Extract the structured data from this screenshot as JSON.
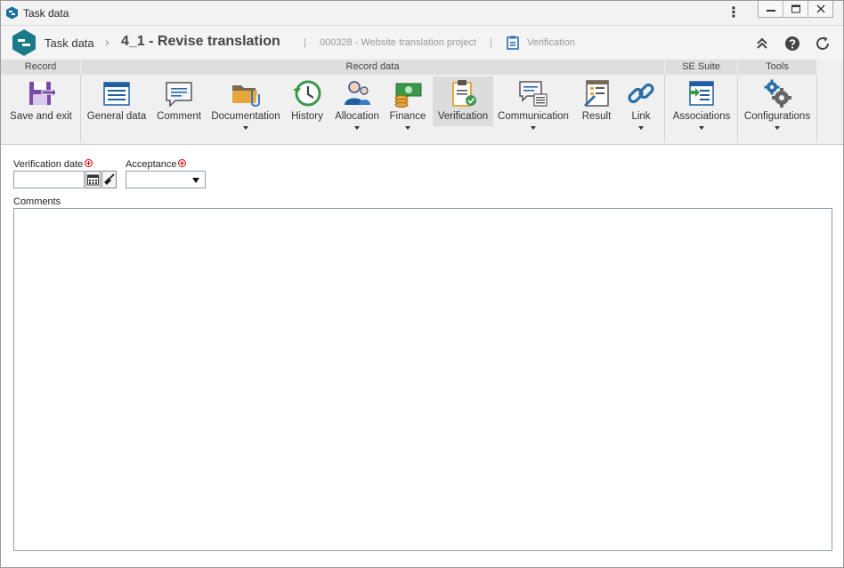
{
  "window": {
    "title": "Task data"
  },
  "header": {
    "task_label": "Task data",
    "main_title": "4_1 - Revise translation",
    "project": "000328 - Website translation project",
    "section": "Verification"
  },
  "ribbon": {
    "groups": {
      "record": "Record",
      "record_data": "Record data",
      "se_suite": "SE Suite",
      "tools": "Tools"
    },
    "buttons": {
      "save_exit": "Save and exit",
      "general_data": "General data",
      "comment": "Comment",
      "documentation": "Documentation",
      "history": "History",
      "allocation": "Allocation",
      "finance": "Finance",
      "verification": "Verification",
      "communication": "Communication",
      "result": "Result",
      "link": "Link",
      "associations": "Associations",
      "configurations": "Configurations"
    }
  },
  "form": {
    "verification_date_label": "Verification date",
    "verification_date_value": "",
    "acceptance_label": "Acceptance",
    "acceptance_value": "",
    "comments_label": "Comments",
    "comments_value": ""
  },
  "colors": {
    "accent": "#1a7a8a",
    "purple": "#7b4aa3",
    "green": "#3a9a4a",
    "required": "#dd0000"
  }
}
